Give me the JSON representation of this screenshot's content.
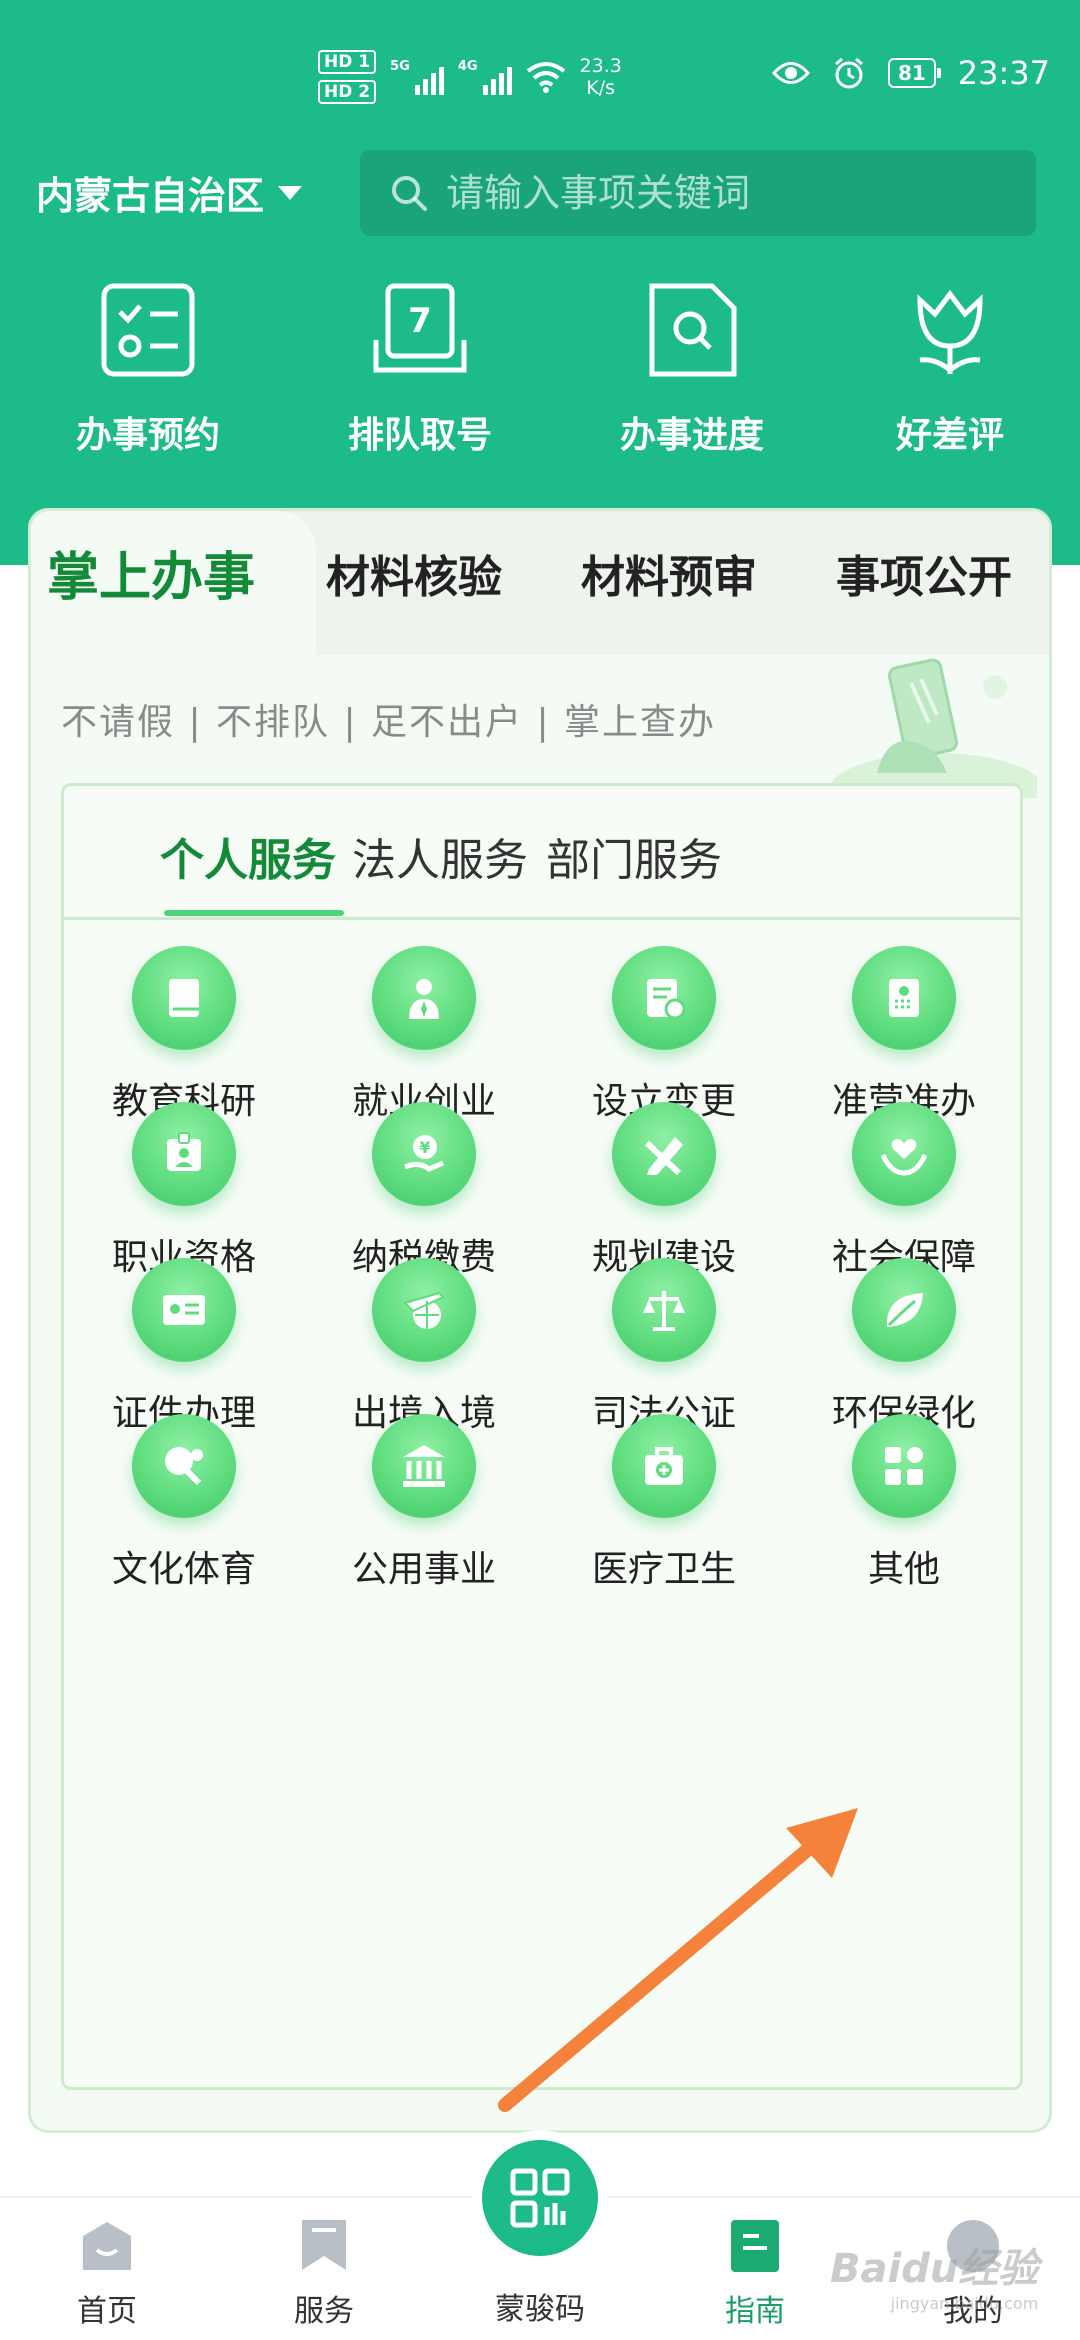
{
  "status_bar": {
    "sim1": "HD 1",
    "sim2": "HD 2",
    "net_speed": "23.3",
    "net_unit": "K/s",
    "battery": "81",
    "time": "23:37"
  },
  "header": {
    "region": "内蒙古自治区",
    "search_placeholder": "请输入事项关键词",
    "background_color": "#1dbb8a"
  },
  "quick_actions": [
    {
      "label": "办事预约",
      "icon": "checklist-icon"
    },
    {
      "label": "排队取号",
      "icon": "queue-ticket-icon"
    },
    {
      "label": "办事进度",
      "icon": "progress-search-icon"
    },
    {
      "label": "好差评",
      "icon": "tulip-icon"
    }
  ],
  "main_tabs": [
    {
      "label": "掌上办事",
      "active": true
    },
    {
      "label": "材料核验",
      "active": false
    },
    {
      "label": "材料预审",
      "active": false
    },
    {
      "label": "事项公开",
      "active": false
    }
  ],
  "slogan": "不请假 | 不排队 | 足不出户 | 掌上查办",
  "service_tabs": [
    {
      "label": "个人服务",
      "active": true
    },
    {
      "label": "法人服务",
      "active": false
    },
    {
      "label": "部门服务",
      "active": false
    }
  ],
  "services": [
    {
      "label": "教育科研",
      "icon": "book-icon"
    },
    {
      "label": "就业创业",
      "icon": "business-person-icon"
    },
    {
      "label": "设立变更",
      "icon": "document-change-icon"
    },
    {
      "label": "准营准办",
      "icon": "license-icon"
    },
    {
      "label": "职业资格",
      "icon": "id-badge-icon"
    },
    {
      "label": "纳税缴费",
      "icon": "tax-hand-icon"
    },
    {
      "label": "规划建设",
      "icon": "pencil-ruler-icon"
    },
    {
      "label": "社会保障",
      "icon": "heart-hands-icon"
    },
    {
      "label": "证件办理",
      "icon": "id-card-icon"
    },
    {
      "label": "出境入境",
      "icon": "plane-globe-icon"
    },
    {
      "label": "司法公证",
      "icon": "scales-icon"
    },
    {
      "label": "环保绿化",
      "icon": "leaf-icon"
    },
    {
      "label": "文化体育",
      "icon": "ping-pong-icon"
    },
    {
      "label": "公用事业",
      "icon": "public-building-icon"
    },
    {
      "label": "医疗卫生",
      "icon": "medical-kit-icon"
    },
    {
      "label": "其他",
      "icon": "apps-grid-icon"
    }
  ],
  "bottom_nav": [
    {
      "label": "首页",
      "icon": "home-icon",
      "active": false
    },
    {
      "label": "服务",
      "icon": "bookmark-icon",
      "active": false
    },
    {
      "label": "蒙骏码",
      "icon": "qr-code-icon",
      "active": false
    },
    {
      "label": "指南",
      "icon": "guide-icon",
      "active": true
    },
    {
      "label": "我的",
      "icon": "profile-icon",
      "active": false
    }
  ],
  "watermark": {
    "text": "Baidu经验",
    "sub": "jingyan.baidu.com"
  },
  "colors": {
    "brand": "#1dbb8a",
    "active_tab": "#138a38",
    "arrow": "#f5823a"
  }
}
